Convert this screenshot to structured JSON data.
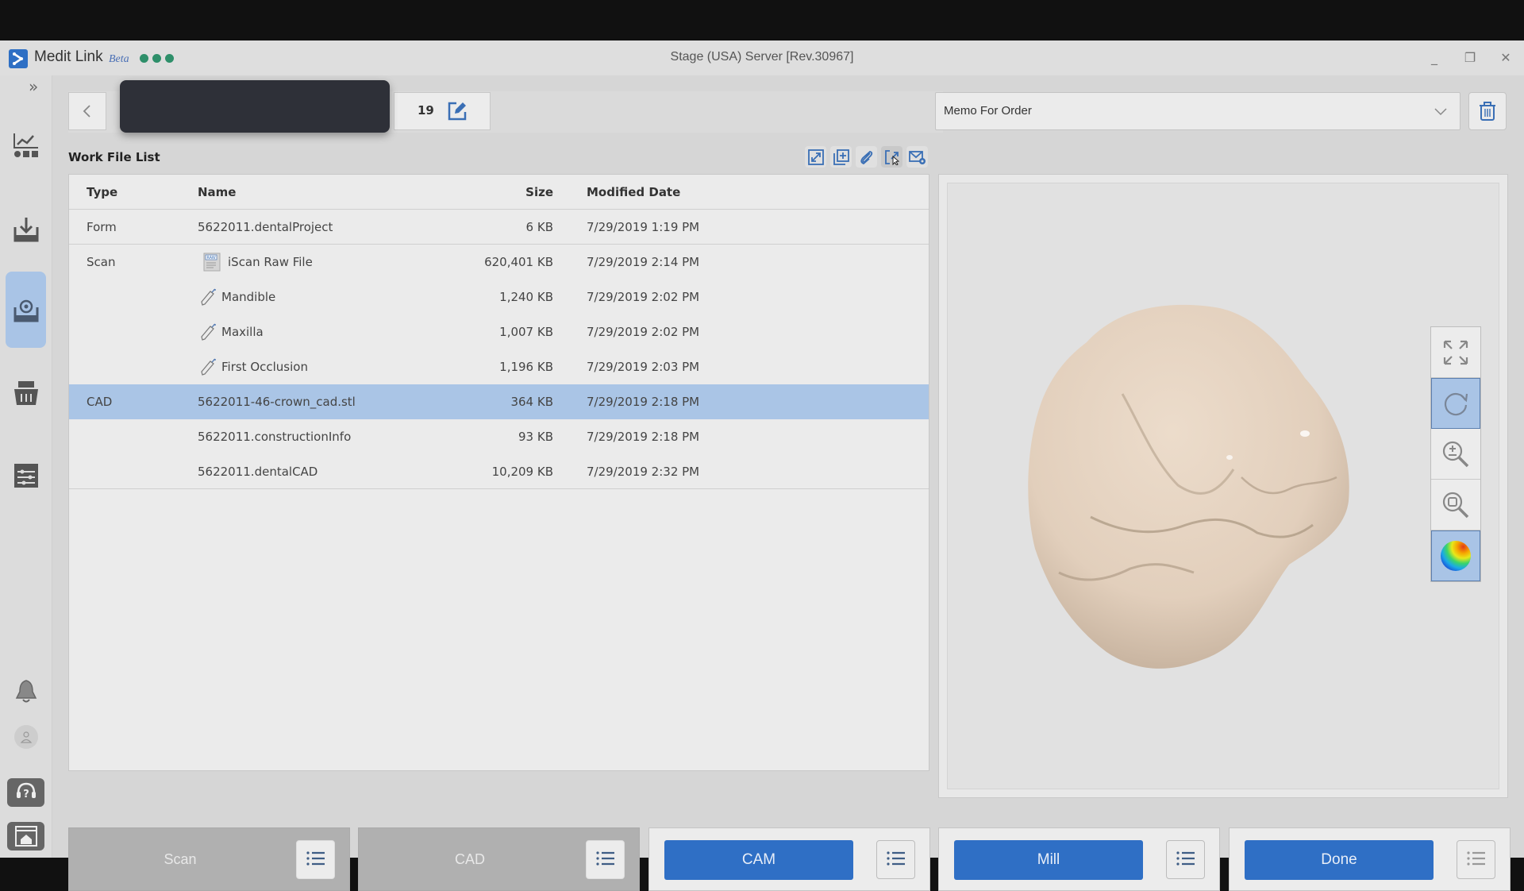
{
  "window": {
    "app_name": "Medit Link",
    "app_tag": "Beta",
    "server_title": "Stage (USA) Server [Rev.30967]",
    "controls": {
      "minimize": "_",
      "maximize": "❐",
      "close": "✕"
    }
  },
  "sidebar": {
    "expand_icon": "»",
    "items": [
      {
        "name": "dashboard",
        "icon": "chart-dashboard-icon",
        "active": false
      },
      {
        "name": "inbox",
        "icon": "inbox-download-icon",
        "active": false
      },
      {
        "name": "work-box",
        "icon": "inbox-sync-icon",
        "active": true
      },
      {
        "name": "cart",
        "icon": "basket-icon",
        "active": false
      },
      {
        "name": "settings",
        "icon": "sliders-icon",
        "active": false
      }
    ],
    "bottom": [
      "bell-icon",
      "user-icon",
      "help-headset-icon",
      "home-window-icon"
    ]
  },
  "header": {
    "case_number_suffix": "19",
    "memo_select": {
      "value": "Memo For Order"
    }
  },
  "work_file_list": {
    "title": "Work File List",
    "toolbar": [
      "expand-icon",
      "add-file-icon",
      "attach-icon",
      "export-icon",
      "mail-settings-icon"
    ],
    "columns": [
      "Type",
      "Name",
      "Size",
      "Modified Date"
    ],
    "rows": [
      {
        "type": "Form",
        "name": "5622011.dentalProject",
        "size": "6 KB",
        "date": "7/29/2019 1:19 PM",
        "icon": "",
        "selected": false,
        "sep": true
      },
      {
        "type": "Scan",
        "name": "iScan Raw File",
        "size": "620,401 KB",
        "date": "7/29/2019 2:14 PM",
        "icon": "raw-file-icon",
        "selected": false,
        "sep": false
      },
      {
        "type": "",
        "name": "Mandible",
        "size": "1,240 KB",
        "date": "7/29/2019 2:02 PM",
        "icon": "scanner-wand-icon",
        "selected": false,
        "sep": false
      },
      {
        "type": "",
        "name": "Maxilla",
        "size": "1,007 KB",
        "date": "7/29/2019 2:02 PM",
        "icon": "scanner-wand-icon",
        "selected": false,
        "sep": false
      },
      {
        "type": "",
        "name": "First Occlusion",
        "size": "1,196 KB",
        "date": "7/29/2019 2:03 PM",
        "icon": "scanner-wand-icon",
        "selected": false,
        "sep": false
      },
      {
        "type": "CAD",
        "name": "5622011-46-crown_cad.stl",
        "size": "364 KB",
        "date": "7/29/2019 2:18 PM",
        "icon": "",
        "selected": true,
        "sep": false
      },
      {
        "type": "",
        "name": "5622011.constructionInfo",
        "size": "93 KB",
        "date": "7/29/2019 2:18 PM",
        "icon": "",
        "selected": false,
        "sep": false
      },
      {
        "type": "",
        "name": "5622011.dentalCAD",
        "size": "10,209 KB",
        "date": "7/29/2019 2:32 PM",
        "icon": "",
        "selected": false,
        "sep": true
      }
    ]
  },
  "viewer": {
    "tools": [
      {
        "name": "fit-view",
        "icon": "fit-expand-icon",
        "active": false
      },
      {
        "name": "rotate",
        "icon": "rotate-icon",
        "active": true
      },
      {
        "name": "zoom",
        "icon": "zoom-plus-minus-icon",
        "active": false
      },
      {
        "name": "zoom-region",
        "icon": "zoom-box-icon",
        "active": false
      },
      {
        "name": "color-map",
        "icon": "color-sphere-icon",
        "active": true
      }
    ]
  },
  "stages": [
    {
      "label": "Scan",
      "enabled": false
    },
    {
      "label": "CAD",
      "enabled": false
    },
    {
      "label": "CAM",
      "enabled": true
    },
    {
      "label": "Mill",
      "enabled": true
    },
    {
      "label": "Done",
      "enabled": true
    }
  ],
  "colors": {
    "accent": "#2f6fc5",
    "selection": "#aac5e6",
    "status_dots": "#2e8f6a",
    "tooth": "#e6d5c3"
  }
}
